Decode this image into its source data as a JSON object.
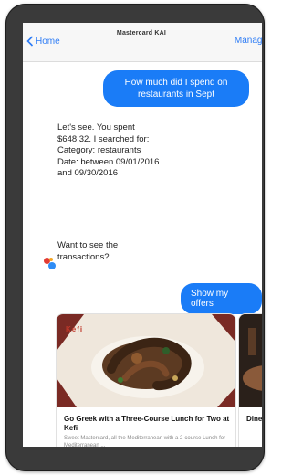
{
  "nav": {
    "back_label": "Home",
    "title": "Mastercard KAI",
    "subtitle": "",
    "manage_label": "Manage"
  },
  "messages": {
    "user_question": "How much did I spend on restaurants in Sept",
    "bot_lines": [
      "Let's see. You spent",
      "$648.32. I searched for:",
      "Category: restaurants",
      "Date: between 09/01/2016",
      "and 09/30/2016"
    ],
    "bot_question_lines": [
      "Want to see the",
      "transactions?"
    ],
    "offers_button": "Show my offers"
  },
  "cards": [
    {
      "brand": "Kefi",
      "title": "Go Greek with a Three-Course Lunch for Two at Kefi",
      "desc": "Sweet Mastercard, all the Mediterranean with a 2-course Lunch for Mediterranean ..."
    },
    {
      "brand": "",
      "title": "Dine",
      "desc": ""
    }
  ],
  "colors": {
    "accent": "#1a7cf7",
    "avatar_red": "#e23b32",
    "avatar_blue": "#2f8df5"
  }
}
